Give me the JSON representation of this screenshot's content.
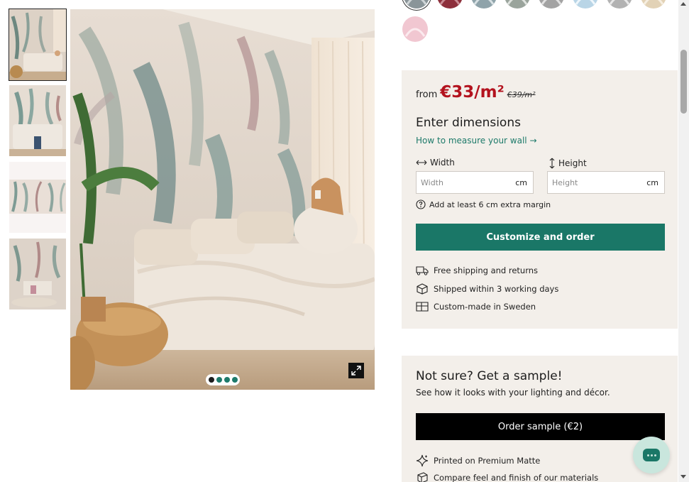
{
  "gallery": {
    "thumbnails": [
      {
        "icon": "bedroom-mural-photo",
        "active": true
      },
      {
        "icon": "leaf-mural-bedroom-photo",
        "active": false
      },
      {
        "icon": "mural-pattern-swatch",
        "active": false
      },
      {
        "icon": "mural-room-sofa-photo",
        "active": false
      }
    ],
    "dots_count": 4,
    "active_dot": 0,
    "expand_icon": "expand-icon"
  },
  "swatches": [
    {
      "color": "#8a9599",
      "selected": true
    },
    {
      "color": "#8d2f3b",
      "selected": false
    },
    {
      "color": "#8fa3aa",
      "selected": false
    },
    {
      "color": "#9aa49c",
      "selected": false
    },
    {
      "color": "#a3a3a3",
      "selected": false
    },
    {
      "color": "#b9d5e6",
      "selected": false
    },
    {
      "color": "#b2b2b2",
      "selected": false
    },
    {
      "color": "#e2d2b6",
      "selected": false
    },
    {
      "color": "#f1c7d1",
      "selected": false
    }
  ],
  "pricing": {
    "from_label": "from",
    "price": "€33/m²",
    "old_price": "€39/m²"
  },
  "dimensions": {
    "title": "Enter dimensions",
    "measure_link": "How to measure your wall →",
    "width_label": "Width",
    "height_label": "Height",
    "width_placeholder": "Width",
    "height_placeholder": "Height",
    "unit": "cm",
    "margin_note": "Add at least 6 cm extra margin"
  },
  "order_button": "Customize and order",
  "features": [
    {
      "icon": "truck-icon",
      "text": "Free shipping and returns"
    },
    {
      "icon": "box-icon",
      "text": "Shipped within 3 working days"
    },
    {
      "icon": "layout-icon",
      "text": "Custom-made in Sweden"
    }
  ],
  "sample": {
    "title": "Not sure? Get a sample!",
    "subtitle": "See how it looks with your lighting and décor.",
    "button": "Order sample (€2)",
    "features": [
      {
        "icon": "sparkle-icon",
        "text": "Printed on Premium Matte"
      },
      {
        "icon": "layers-icon",
        "text": "Compare feel and finish of our materials"
      }
    ]
  },
  "colors": {
    "accent": "#1a7767",
    "price": "#b3121e",
    "panel_bg": "#f3efea"
  }
}
